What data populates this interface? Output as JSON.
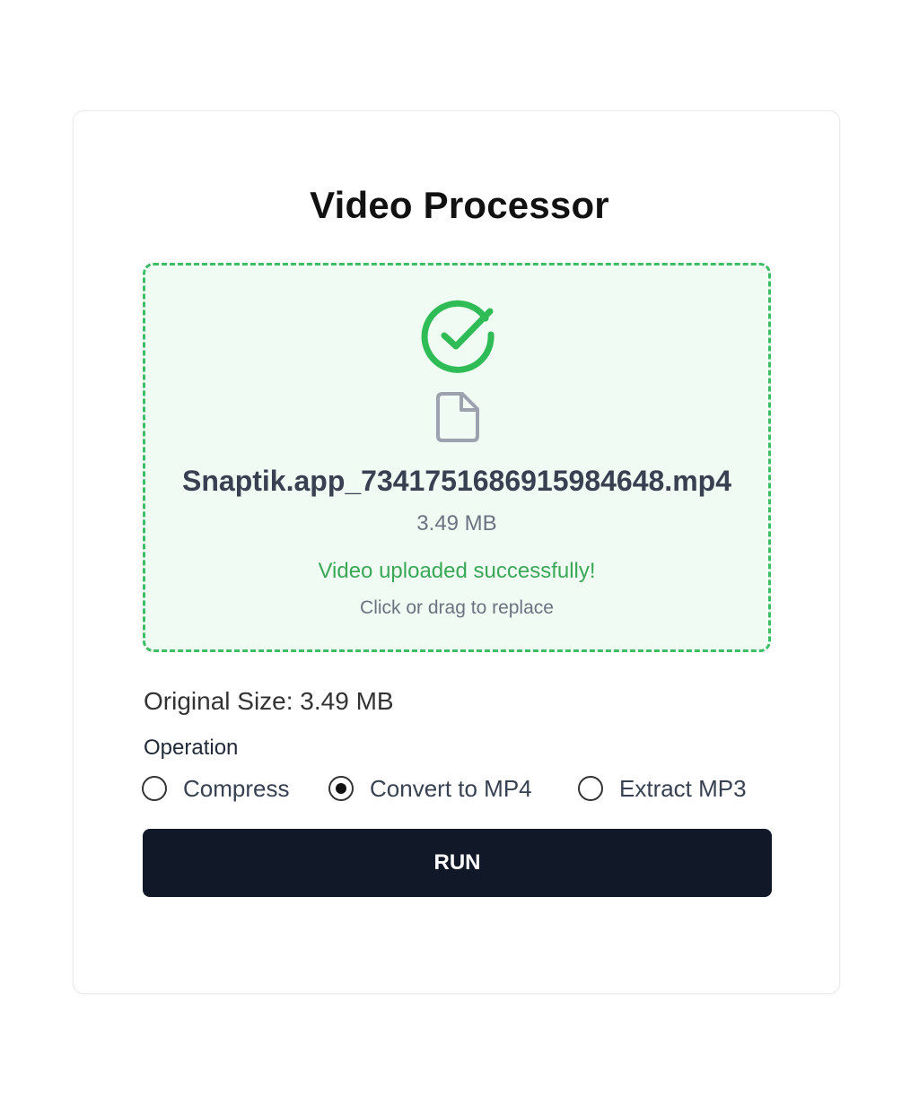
{
  "app": {
    "title": "Video Processor"
  },
  "upload": {
    "status_icon": "check-circle-icon",
    "file_icon": "file-icon",
    "file_name": "Snaptik.app_7341751686915984648.mp4",
    "file_size": "3.49 MB",
    "success_message": "Video uploaded successfully!",
    "hint": "Click or drag to replace",
    "colors": {
      "border": "#3dbd65",
      "background": "#f0fbf3",
      "success_text": "#3aa857"
    }
  },
  "info": {
    "original_size": "Original Size: 3.49 MB"
  },
  "operation": {
    "label": "Operation",
    "selected": "convert",
    "options": [
      {
        "id": "compress",
        "label": "Compress",
        "checked": false
      },
      {
        "id": "convert",
        "label": "Convert to MP4",
        "checked": true
      },
      {
        "id": "extract",
        "label": "Extract MP3",
        "checked": false
      }
    ]
  },
  "actions": {
    "run_label": "RUN",
    "run_color": "#111827"
  }
}
